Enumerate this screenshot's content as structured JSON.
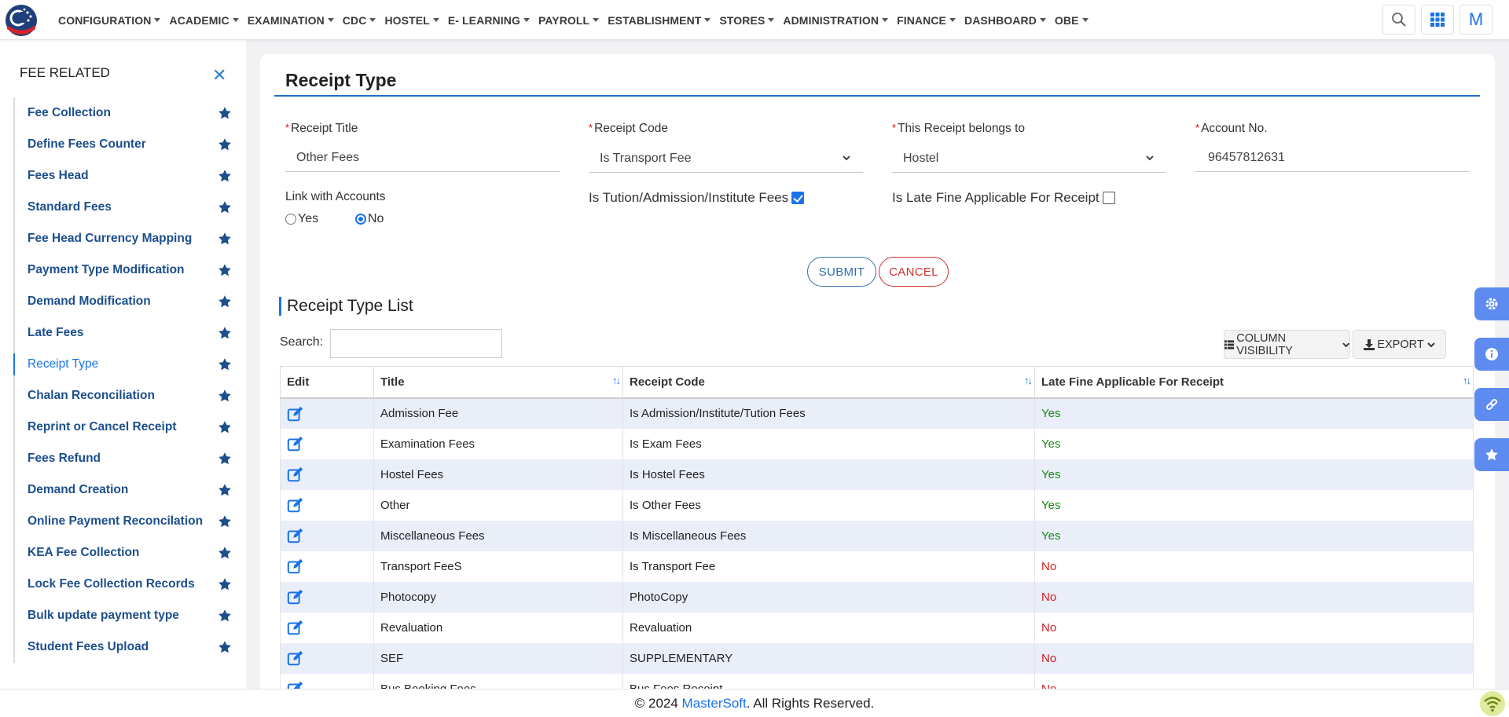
{
  "nav": {
    "items": [
      {
        "label": "CONFIGURATION"
      },
      {
        "label": "ACADEMIC"
      },
      {
        "label": "EXAMINATION"
      },
      {
        "label": "CDC"
      },
      {
        "label": "HOSTEL"
      },
      {
        "label": "E- LEARNING"
      },
      {
        "label": "PAYROLL"
      },
      {
        "label": "ESTABLISHMENT"
      },
      {
        "label": "STORES"
      },
      {
        "label": "ADMINISTRATION"
      },
      {
        "label": "FINANCE"
      },
      {
        "label": "DASHBOARD"
      },
      {
        "label": "OBE"
      }
    ],
    "user_initial": "M"
  },
  "sidebar": {
    "heading": "FEE RELATED",
    "close_glyph": "✕",
    "items": [
      {
        "label": "Fee Collection"
      },
      {
        "label": "Define Fees Counter"
      },
      {
        "label": "Fees Head"
      },
      {
        "label": "Standard Fees"
      },
      {
        "label": "Fee Head Currency Mapping"
      },
      {
        "label": "Payment Type Modification"
      },
      {
        "label": "Demand Modification"
      },
      {
        "label": "Late Fees"
      },
      {
        "label": "Receipt Type",
        "active": true
      },
      {
        "label": "Chalan Reconciliation"
      },
      {
        "label": "Reprint or Cancel Receipt"
      },
      {
        "label": "Fees Refund"
      },
      {
        "label": "Demand Creation"
      },
      {
        "label": "Online Payment Reconcilation"
      },
      {
        "label": "KEA Fee Collection"
      },
      {
        "label": "Lock Fee Collection Records"
      },
      {
        "label": "Bulk update payment type"
      },
      {
        "label": "Student Fees Upload"
      }
    ]
  },
  "form": {
    "title": "Receipt Type",
    "receipt_title": {
      "label": "Receipt Title",
      "value": "Other Fees"
    },
    "receipt_code": {
      "label": "Receipt Code",
      "value": "Is Transport Fee"
    },
    "belongs_to": {
      "label": "This Receipt belongs to",
      "value": "Hostel"
    },
    "account_no": {
      "label": "Account No.",
      "value": "96457812631"
    },
    "link_accounts": {
      "label": "Link with Accounts",
      "yes": "Yes",
      "no": "No",
      "selected": "No"
    },
    "tution_fees": {
      "label": "Is Tution/Admission/Institute Fees",
      "checked": true
    },
    "late_fine": {
      "label": "Is Late Fine Applicable For Receipt",
      "checked": false
    },
    "submit_label": "SUBMIT",
    "cancel_label": "CANCEL"
  },
  "list": {
    "title": "Receipt Type List",
    "search_label": "Search:",
    "colvis_label": "COLUMN VISIBILITY",
    "export_label": "EXPORT",
    "columns": [
      "Edit",
      "Title",
      "Receipt Code",
      "Late Fine Applicable For Receipt"
    ],
    "rows": [
      {
        "title": "Admission Fee",
        "code": "Is Admission/Institute/Tution Fees",
        "late": "Yes"
      },
      {
        "title": "Examination Fees",
        "code": "Is Exam Fees",
        "late": "Yes"
      },
      {
        "title": "Hostel Fees",
        "code": "Is Hostel Fees",
        "late": "Yes"
      },
      {
        "title": "Other",
        "code": "Is Other Fees",
        "late": "Yes"
      },
      {
        "title": "Miscellaneous Fees",
        "code": "Is Miscellaneous Fees",
        "late": "Yes"
      },
      {
        "title": "Transport FeeS",
        "code": "Is Transport Fee",
        "late": "No"
      },
      {
        "title": "Photocopy",
        "code": "PhotoCopy",
        "late": "No"
      },
      {
        "title": "Revaluation",
        "code": "Revaluation",
        "late": "No"
      },
      {
        "title": "SEF",
        "code": "SUPPLEMENTARY",
        "late": "No"
      },
      {
        "title": "Bus Booking Fees",
        "code": "Bus Fees Receipt",
        "late": "No"
      }
    ]
  },
  "footer": {
    "prefix": "© 2024 ",
    "brand": "MasterSoft",
    "suffix": ". All Rights Reserved."
  },
  "colors": {
    "accent": "#1a73e8",
    "nav_link": "#1d4f8c",
    "yes": "#1a8a1a",
    "no": "#d41c1c",
    "float_tab": "#5e8bf0"
  }
}
